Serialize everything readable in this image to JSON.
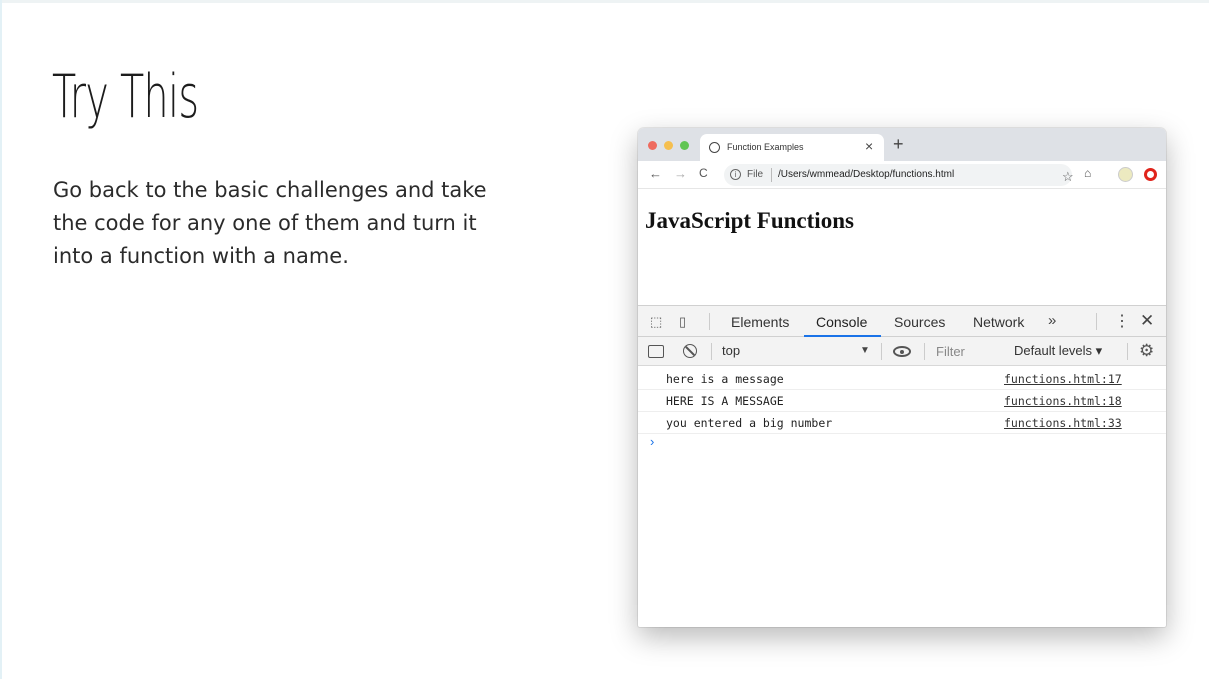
{
  "slide": {
    "title": "Try This",
    "body": "Go back to the basic challenges and take the code for any one of them and turn it into a function with a name."
  },
  "browser": {
    "tab_title": "Function Examples",
    "tab_close": "×",
    "new_tab": "+",
    "nav": {
      "back": "←",
      "forward": "→",
      "reload": "C"
    },
    "address": {
      "scheme_label": "File",
      "url": "/Users/wmmead/Desktop/functions.html"
    },
    "page_heading": "JavaScript Functions"
  },
  "devtools": {
    "tabs": [
      {
        "label": "Elements",
        "active": false
      },
      {
        "label": "Console",
        "active": true
      },
      {
        "label": "Sources",
        "active": false
      },
      {
        "label": "Network",
        "active": false
      }
    ],
    "more_tabs": "»",
    "kebab": "⋮",
    "close": "✕",
    "console_bar": {
      "context": "top",
      "context_arrow": "▼",
      "filter_placeholder": "Filter",
      "levels": "Default levels ▾"
    },
    "messages": [
      {
        "text": "here is a message",
        "source": "functions.html:17"
      },
      {
        "text": "HERE IS A MESSAGE",
        "source": "functions.html:18"
      },
      {
        "text": "you entered a big number",
        "source": "functions.html:33"
      }
    ],
    "prompt": "›"
  },
  "colors": {
    "accent": "#1a73e8",
    "traffic_red": "#ee6b5f",
    "traffic_yellow": "#f5bf4f",
    "traffic_green": "#61c554"
  }
}
